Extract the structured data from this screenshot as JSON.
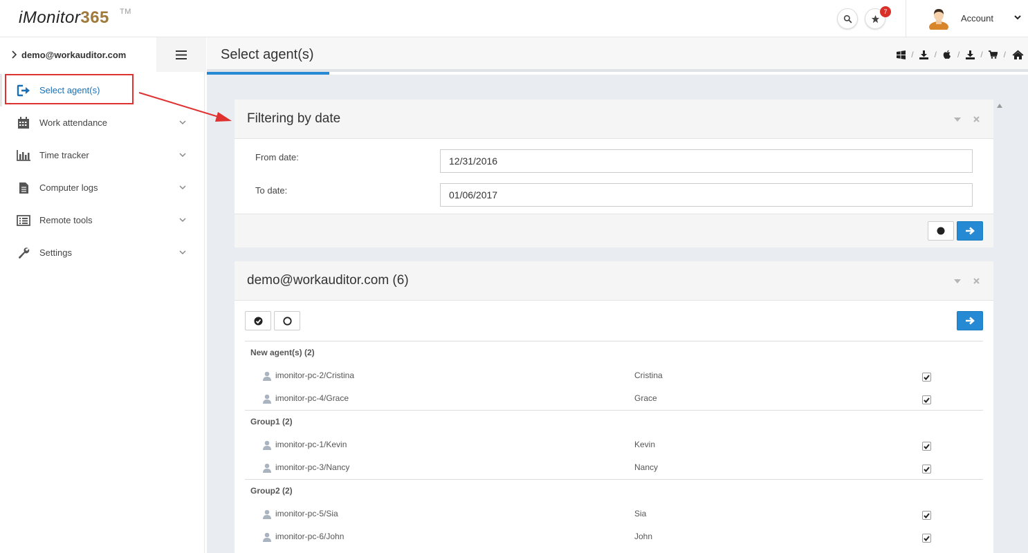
{
  "app": {
    "logo_text": "iMonitor",
    "logo_num": "365",
    "logo_tm": "TM",
    "notifications": "7",
    "account_label": "Account"
  },
  "sidebar": {
    "user": "demo@workauditor.com",
    "items": [
      {
        "label": "Select agent(s)",
        "icon": "sign-in-icon",
        "active": true
      },
      {
        "label": "Work attendance",
        "icon": "calendar-icon"
      },
      {
        "label": "Time tracker",
        "icon": "bar-chart-icon"
      },
      {
        "label": "Computer logs",
        "icon": "document-icon"
      },
      {
        "label": "Remote tools",
        "icon": "list-icon"
      },
      {
        "label": "Settings",
        "icon": "wrench-icon"
      }
    ]
  },
  "page": {
    "title": "Select agent(s)",
    "toolbar_icons": [
      "windows-icon",
      "download-icon",
      "apple-icon",
      "download-icon",
      "cart-icon",
      "home-icon"
    ]
  },
  "filter_panel": {
    "title": "Filtering by date",
    "from_label": "From date:",
    "from_value": "12/31/2016",
    "to_label": "To date:",
    "to_value": "01/06/2017"
  },
  "agents_panel": {
    "title": "demo@workauditor.com (6)",
    "groups": [
      {
        "name": "New agent(s) (2)",
        "agents": [
          {
            "computer": "imonitor-pc-2/Cristina",
            "user": "Cristina",
            "checked": true
          },
          {
            "computer": "imonitor-pc-4/Grace",
            "user": "Grace",
            "checked": true
          }
        ]
      },
      {
        "name": "Group1 (2)",
        "agents": [
          {
            "computer": "imonitor-pc-1/Kevin",
            "user": "Kevin",
            "checked": true
          },
          {
            "computer": "imonitor-pc-3/Nancy",
            "user": "Nancy",
            "checked": true
          }
        ]
      },
      {
        "name": "Group2 (2)",
        "agents": [
          {
            "computer": "imonitor-pc-5/Sia",
            "user": "Sia",
            "checked": true
          },
          {
            "computer": "imonitor-pc-6/John",
            "user": "John",
            "checked": true
          }
        ]
      }
    ]
  },
  "colors": {
    "accent": "#2589d3",
    "annotation_red": "#e03131",
    "badge_red": "#d9302a",
    "logo_gold": "#a07a3a"
  }
}
